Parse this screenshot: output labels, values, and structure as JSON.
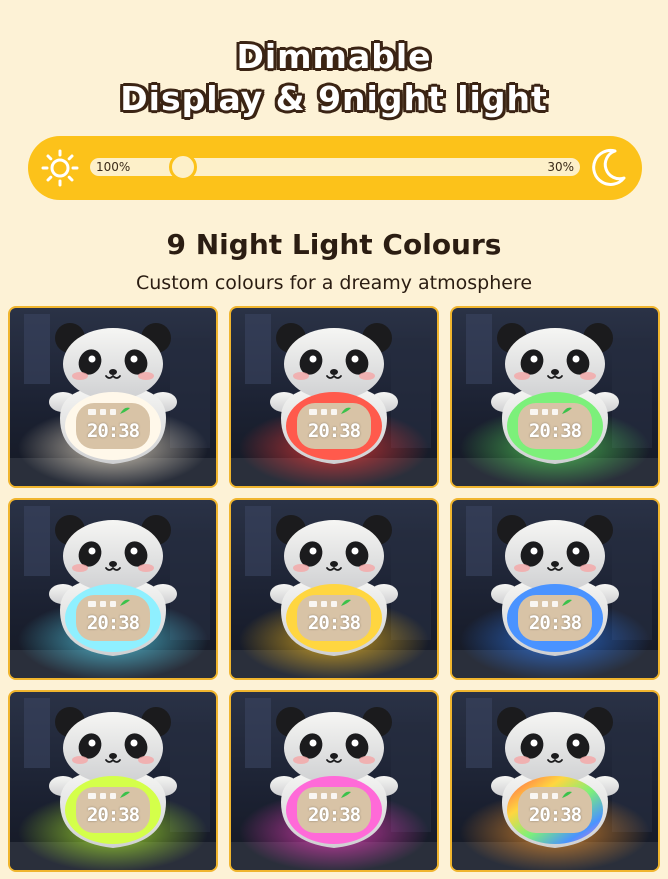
{
  "header": {
    "title_line1": "Dimmable",
    "title_line2": "Display & 9night light"
  },
  "brightness_slider": {
    "min_label": "100%",
    "max_label": "30%",
    "level_fraction": 0.19,
    "left_icon": "sun-icon",
    "right_icon": "moon-icon",
    "colors": {
      "pill": "#fcc21a",
      "track": "#fdf0c9"
    }
  },
  "section": {
    "heading": "9 Night Light Colours",
    "subheading": "Custom colours for a dreamy atmosphere"
  },
  "clocks": [
    {
      "time": "20:38",
      "glow": "#fff1d6",
      "ring": "#fff8ea"
    },
    {
      "time": "20:38",
      "glow": "#ff3a36",
      "ring": "#ff5a4c"
    },
    {
      "time": "20:38",
      "glow": "#56e05a",
      "ring": "#7cf07a"
    },
    {
      "time": "20:38",
      "glow": "#57d8f2",
      "ring": "#8ff0ff"
    },
    {
      "time": "20:38",
      "glow": "#ffc21a",
      "ring": "#ffd640"
    },
    {
      "time": "20:38",
      "glow": "#2f7cf2",
      "ring": "#4a93ff"
    },
    {
      "time": "20:38",
      "glow": "#b9ff2a",
      "ring": "#d4ff4a"
    },
    {
      "time": "20:38",
      "glow": "#ff3fc7",
      "ring": "#ff6ad8"
    },
    {
      "time": "20:38",
      "glow": "#ff9a2a",
      "ring": "rainbow"
    }
  ]
}
